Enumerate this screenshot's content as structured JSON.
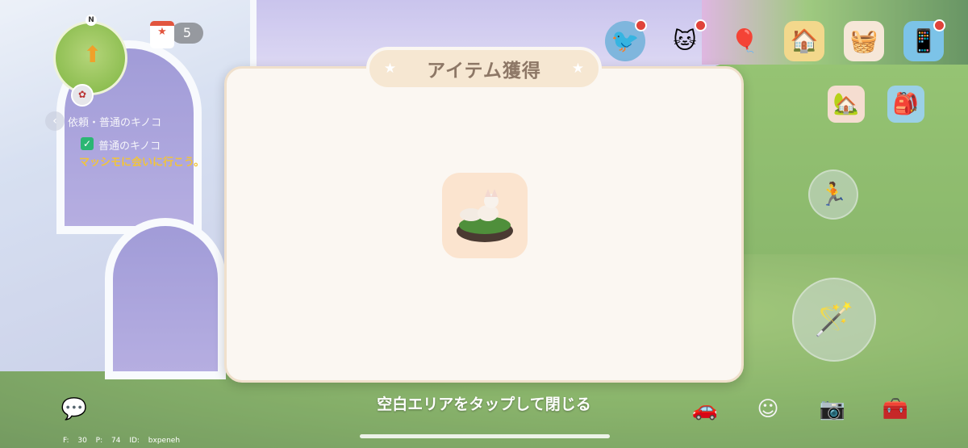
{
  "modal": {
    "title": "アイテム獲得",
    "star_glyph": "★",
    "item_icon": "fox-figurine-icon",
    "close_hint": "空白エリアをタップして閉じる"
  },
  "hud": {
    "compass_label": "N",
    "calendar_count": "5",
    "quest": {
      "title": "依頼・普通のキノコ",
      "subtask": "普通のキノコ",
      "hint": "マッシモに会いに行こう。"
    },
    "debug": {
      "text": "F: 30  P: 74  ID: bxpeneh"
    }
  },
  "icons": {
    "top": [
      "balloon-bird-icon",
      "cat-npc-icon",
      "balloons-icon",
      "gift-shop-icon",
      "basket-icon",
      "phone-icon"
    ],
    "side": [
      "house-icon",
      "backpack-icon"
    ],
    "bottom": [
      "chat-icon",
      "car-icon",
      "emote-icon",
      "camera-icon",
      "toolbox-icon"
    ]
  },
  "colors": {
    "modal_bg": "#fbf7f2",
    "tab_bg": "#f6e7d2",
    "title_text": "#8d7766",
    "hint_yellow": "#f1c43a"
  }
}
